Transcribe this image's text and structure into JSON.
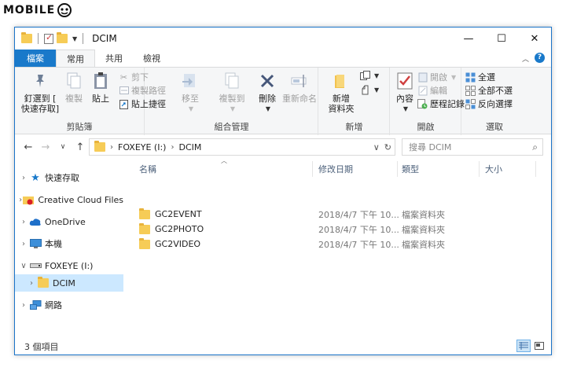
{
  "watermark": "MOBILE",
  "window": {
    "title": "DCIM",
    "controls": [
      "—",
      "☐",
      "✕"
    ]
  },
  "ribbon_tabs": [
    {
      "label": "檔案"
    },
    {
      "label": "常用"
    },
    {
      "label": "共用"
    },
    {
      "label": "檢視"
    }
  ],
  "clipboard": {
    "pin_label_1": "釘選到 [",
    "pin_label_2": "快速存取]",
    "copy_label": "複製",
    "paste_label": "貼上",
    "cut_label": "剪下",
    "copy_path_label": "複製路徑",
    "paste_shortcut_label": "貼上捷徑",
    "group_label": "剪貼簿"
  },
  "organize": {
    "move_label": "移至",
    "copy_to_label": "複製到",
    "delete_label": "刪除",
    "rename_label": "重新命名",
    "group_label": "組合管理"
  },
  "new": {
    "new_folder_label_1": "新增",
    "new_folder_label_2": "資料夾",
    "group_label": "新增"
  },
  "open": {
    "properties_label": "內容",
    "open_label": "開啟",
    "edit_label": "編輯",
    "history_label": "歷程記錄",
    "group_label": "開啟"
  },
  "select": {
    "select_all_label": "全選",
    "select_none_label": "全部不選",
    "invert_label": "反向選擇",
    "group_label": "選取"
  },
  "address": {
    "drive": "FOXEYE (I:)",
    "folder": "DCIM",
    "search_placeholder": "搜尋 DCIM"
  },
  "nav_pane": {
    "items": [
      {
        "label": "快速存取"
      },
      {
        "label": "Creative Cloud Files"
      },
      {
        "label": "OneDrive"
      },
      {
        "label": "本機"
      },
      {
        "label": "FOXEYE (I:)"
      },
      {
        "label": "DCIM"
      },
      {
        "label": "網路"
      }
    ]
  },
  "file_list": {
    "columns": {
      "name": "名稱",
      "modified": "修改日期",
      "type": "類型",
      "size": "大小"
    },
    "rows": [
      {
        "name": "GC2EVENT",
        "modified": "2018/4/7 下午 10...",
        "type": "檔案資料夾",
        "size": ""
      },
      {
        "name": "GC2PHOTO",
        "modified": "2018/4/7 下午 10...",
        "type": "檔案資料夾",
        "size": ""
      },
      {
        "name": "GC2VIDEO",
        "modified": "2018/4/7 下午 10...",
        "type": "檔案資料夾",
        "size": ""
      }
    ]
  },
  "status": {
    "item_count": "3 個項目"
  },
  "colors": {
    "file_tab": "#1979ca",
    "selection": "#cce8ff",
    "folder": "#f6cc57"
  }
}
